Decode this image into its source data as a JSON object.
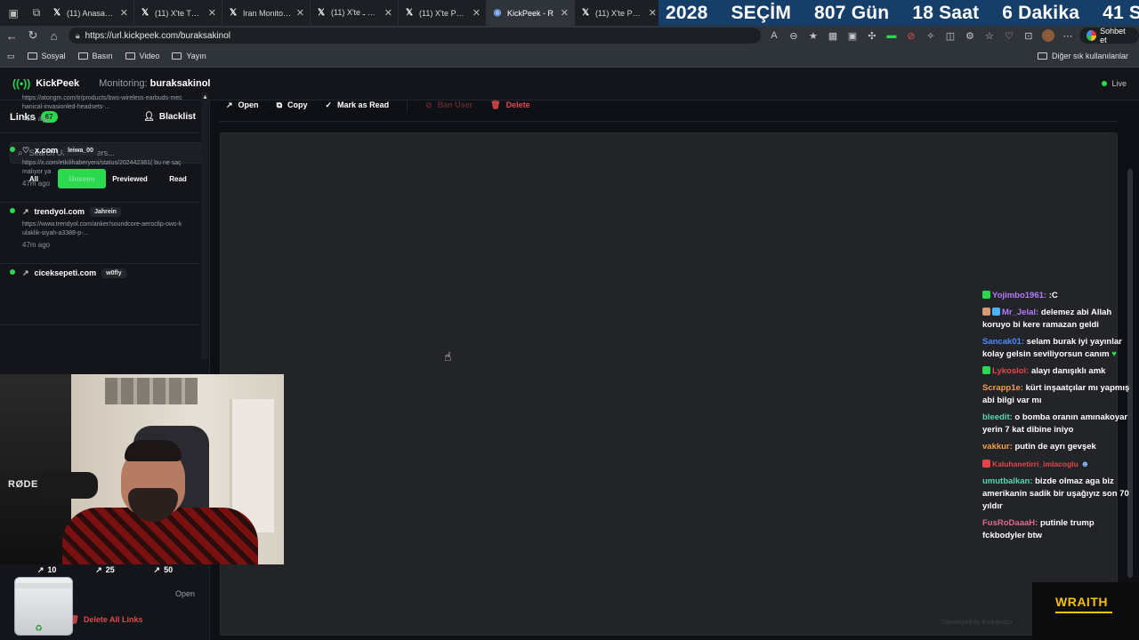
{
  "browser": {
    "tabs": [
      {
        "icon": "x-logo-icon",
        "title": "(11) Anasayfa / X"
      },
      {
        "icon": "x-logo-icon",
        "title": "(11) X'te The Phil"
      },
      {
        "icon": "x-logo-icon",
        "title": "Iran Monitor | Re"
      },
      {
        "icon": "x-logo-icon",
        "title": "(11) X'te نظری ـ"
      },
      {
        "icon": "x-logo-icon",
        "title": "(11) X'te Pouria Z"
      },
      {
        "icon": "kickpeek-icon",
        "title": "KickPeek - R"
      },
      {
        "icon": "x-logo-icon",
        "title": "(11) X'te Pusholc"
      }
    ],
    "countdown": [
      "2028",
      "SEÇİM",
      "807 Gün",
      "18 Saat",
      "6 Dakika",
      "41 Saniye"
    ],
    "url": "https://url.kickpeek.com/buraksakinol",
    "chat_button": "Sohbet et",
    "bookmarks": [
      "Sosyal",
      "Basın",
      "Video",
      "Yayın"
    ],
    "other_bookmarks": "Diğer sık kullanılanlar"
  },
  "app": {
    "logo_text": "KickPeek",
    "monitoring_label": "Monitoring:",
    "monitoring_user": "buraksakinol",
    "live_label": "Live"
  },
  "sidebar": {
    "links_label": "Links",
    "links_count": "67",
    "blacklist_label": "Blacklist",
    "search_placeholder": "Search URLs or users...",
    "filters": [
      "All",
      "Unseen",
      "Previewed",
      "Read"
    ],
    "active_filter": "Unseen",
    "items": [
      {
        "domain": "",
        "user": "",
        "url": "https://atongm.com/tr/products/bws-wireless-earbuds-mechanical-invasionled-headsets-...",
        "time": "46m ago"
      },
      {
        "domain": "x.com",
        "user": "leiwa_00",
        "url": "https://x.com/etkilihaberyeni/status/202442381( bu ne saçmalıyor ya",
        "time": "47m ago"
      },
      {
        "domain": "trendyol.com",
        "user": "Jahrein",
        "url": "https://www.trendyol.com/anker/soundcore-aeroclip-ows-kulaklik-siyah-a3388-p-...",
        "time": "47m ago"
      },
      {
        "domain": "ciceksepeti.com",
        "user": "w0fly",
        "url": "",
        "time": ""
      }
    ],
    "stats": [
      "10",
      "25",
      "50"
    ],
    "open_label": "Open",
    "delete_all_label": "Delete All Links"
  },
  "toolbar": {
    "open": "Open",
    "copy": "Copy",
    "mark_read": "Mark as Read",
    "ban_user": "Ban User",
    "delete": "Delete"
  },
  "webcam": {
    "mic_brand": "RØDE"
  },
  "chat": [
    {
      "user": "Yojimbo1961:",
      "color": "#b57cff",
      "text": ":C"
    },
    {
      "user": "Mr_Jelal:",
      "color": "#b57cff",
      "text": "delemez abi Allah koruyo bi kere ramazan geldi"
    },
    {
      "user": "Sancak01:",
      "color": "#4b8bff",
      "text": "selam burak iyi yayınlar kolay gelsin seviliyorsun canım"
    },
    {
      "user": "Lykoslol:",
      "color": "#e0474c",
      "text": "alayı danışıklı amk"
    },
    {
      "user": "Scrapp1e:",
      "color": "#f0a040",
      "text": "kürt inşaatçılar mı yapmış abi bilgi var mı"
    },
    {
      "user": "bleedit:",
      "color": "#5ad6b4",
      "text": "o bomba oranın amınakoyar yerin 7 kat dibine iniyo"
    },
    {
      "user": "vakkur:",
      "color": "#f0a040",
      "text": "putin de ayrı gevşek"
    },
    {
      "user": "Kaluhanetirri_imlacoglu",
      "color": "#e0474c",
      "text": ""
    },
    {
      "user": "umutbalkan:",
      "color": "#5ad6b4",
      "text": "bizde olmaz aga biz amerikanin sadik bir uşağıyız son 70 yıldır"
    },
    {
      "user": "FusRoDaaaH:",
      "color": "#e06a8a",
      "text": "putinle trump fckbodyler btw"
    }
  ],
  "overlay": {
    "wraith": "WRAITH",
    "developed_by": "Developed by Kodumuzu"
  },
  "colors": {
    "accent": "#2bd94f",
    "danger": "#e0474c",
    "countdown_bg": "#153f68"
  }
}
